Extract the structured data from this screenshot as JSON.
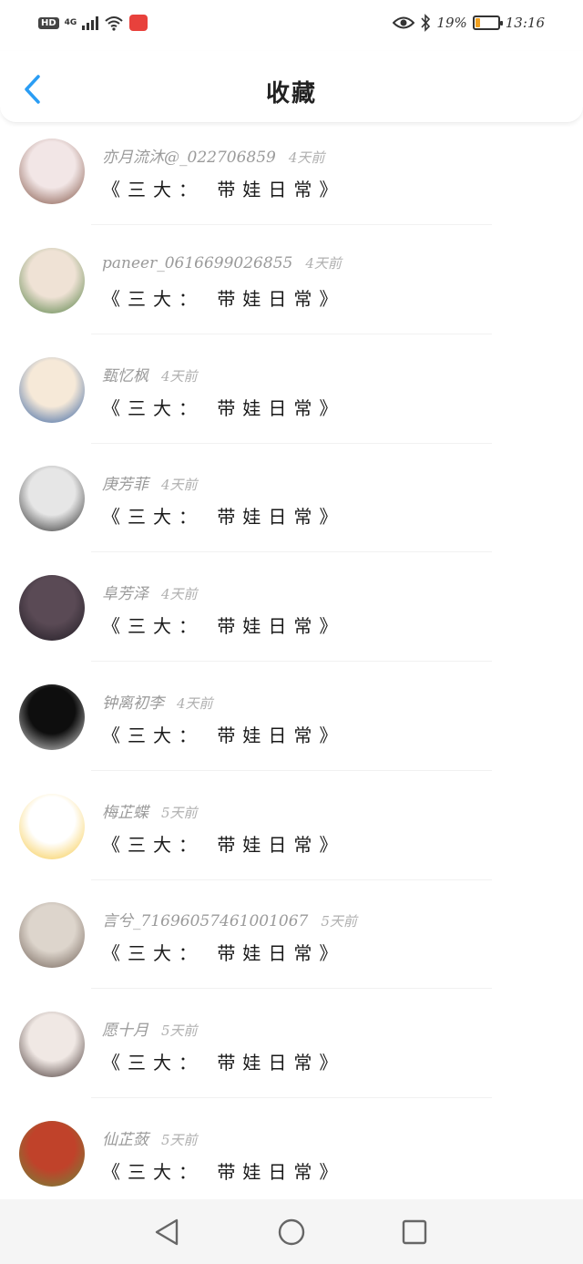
{
  "status_bar": {
    "hd": "HD",
    "network": "4G",
    "battery_percent": "19%",
    "time": "13:16",
    "battery_level": 0.19,
    "icons": [
      "wifi-icon",
      "huawei-app-icon",
      "eye-icon",
      "bluetooth-icon",
      "battery-icon"
    ]
  },
  "header": {
    "title": "收藏",
    "back_icon": "chevron-left-icon",
    "accent_color": "#2a9df4"
  },
  "items": [
    {
      "name": "亦月流沐@_022706859",
      "time": "4天前",
      "content": "《三大： 带娃日常》",
      "avatar_palette": [
        "#f2e6e6",
        "#7a4a3a"
      ]
    },
    {
      "name": "paneer_0616699026855",
      "time": "4天前",
      "content": "《三大： 带娃日常》",
      "avatar_palette": [
        "#efe2d5",
        "#4a7a3a"
      ]
    },
    {
      "name": "甄忆枫",
      "time": "4天前",
      "content": "《三大： 带娃日常》",
      "avatar_palette": [
        "#f6e9d8",
        "#2a5aa0"
      ]
    },
    {
      "name": "庚芳菲",
      "time": "4天前",
      "content": "《三大： 带娃日常》",
      "avatar_palette": [
        "#e6e6e6",
        "#222222"
      ]
    },
    {
      "name": "阜芳泽",
      "time": "4天前",
      "content": "《三大： 带娃日常》",
      "avatar_palette": [
        "#5a4a55",
        "#1e1a22"
      ]
    },
    {
      "name": "钟离初李",
      "time": "4天前",
      "content": "《三大： 带娃日常》",
      "avatar_palette": [
        "#0e0e0e",
        "#e0e0e0"
      ]
    },
    {
      "name": "梅芷蝶",
      "time": "5天前",
      "content": "《三大： 带娃日常》",
      "avatar_palette": [
        "#ffffff",
        "#f6c53a"
      ]
    },
    {
      "name": "言兮_7169605746100106​7",
      "time": "5天前",
      "content": "《三大： 带娃日常》",
      "avatar_palette": [
        "#ddd5cc",
        "#6a5a50"
      ]
    },
    {
      "name": "愿十月",
      "time": "5天前",
      "content": "《三大： 带娃日常》",
      "avatar_palette": [
        "#f0e8e4",
        "#3a2a28"
      ]
    },
    {
      "name": "仙芷蔹",
      "time": "5天前",
      "content": "《三大： 带娃日常》",
      "avatar_palette": [
        "#c0422a",
        "#6a8a3a"
      ]
    }
  ],
  "nav_bar": {
    "back_icon": "triangle-back-icon",
    "home_icon": "circle-home-icon",
    "recents_icon": "square-recents-icon"
  }
}
